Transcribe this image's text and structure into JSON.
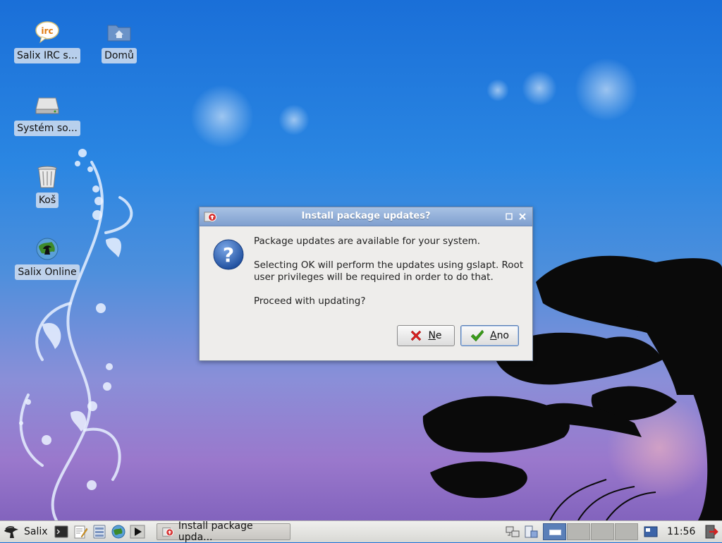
{
  "desktop": {
    "icons": [
      {
        "label": "Salix IRC s..."
      },
      {
        "label": "Domů"
      },
      {
        "label": "Systém so..."
      },
      {
        "label": "Koš"
      },
      {
        "label": "Salix Online"
      }
    ]
  },
  "dialog": {
    "title": "Install package updates?",
    "messages": [
      "Package updates are available for your system.",
      "Selecting OK will perform the updates using gslapt. Root user privileges will be required in order to do that.",
      "Proceed with updating?"
    ],
    "no_button": {
      "mnemonic": "N",
      "rest": "e"
    },
    "yes_button": {
      "mnemonic": "A",
      "rest": "no"
    }
  },
  "taskbar": {
    "start_label": "Salix",
    "launchers": [
      "terminal-icon",
      "text-editor-icon",
      "file-manager-icon",
      "web-browser-icon",
      "media-player-icon"
    ],
    "window_task": "Install package upda...",
    "workspaces": 4,
    "active_workspace": 1,
    "clock": "11:56"
  },
  "colors": {
    "titlebar": "#8fabd8",
    "question_blue": "#2d5da8",
    "no_red": "#d62020",
    "yes_green": "#3a9a1a"
  }
}
